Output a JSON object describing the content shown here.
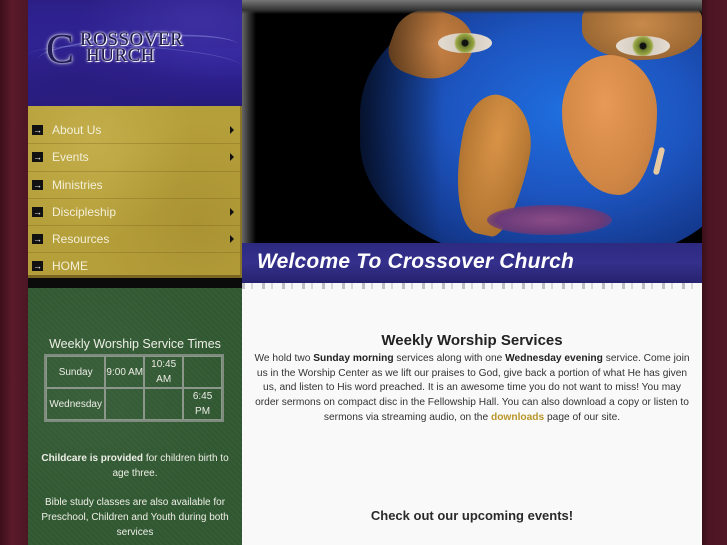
{
  "site": {
    "logo_line1": "ROSSOVER",
    "logo_line2": "HURCH",
    "logo_initial": "C",
    "logo_alt": "Crossover Church"
  },
  "nav": {
    "items": [
      {
        "label": "About Us",
        "has_submenu": true,
        "icon": "arrow-right-icon"
      },
      {
        "label": "Events",
        "has_submenu": true,
        "icon": "arrow-right-icon"
      },
      {
        "label": "Ministries",
        "has_submenu": false,
        "icon": "arrow-right-icon"
      },
      {
        "label": "Discipleship",
        "has_submenu": true,
        "icon": "arrow-right-icon"
      },
      {
        "label": "Resources",
        "has_submenu": true,
        "icon": "arrow-right-icon"
      },
      {
        "label": "HOME",
        "has_submenu": false,
        "icon": "arrow-right-icon"
      }
    ]
  },
  "sidebar": {
    "title": "Weekly Worship Service Times",
    "schedule": [
      {
        "day": "Sunday",
        "times": [
          "9:00 AM",
          "10:45 AM",
          ""
        ]
      },
      {
        "day": "Wednesday",
        "times": [
          "",
          "",
          "6:45 PM"
        ]
      }
    ],
    "childcare_bold": "Childcare is provided",
    "childcare_rest": " for children birth to age three.",
    "bible_study": "Bible study classes are also available for Preschool, Children and Youth during both services"
  },
  "hero": {
    "welcome_title": "Welcome To Crossover Church"
  },
  "content": {
    "heading": "Weekly Worship Services",
    "p_part1": "We hold two ",
    "p_bold1": "Sunday morning",
    "p_part2": " services along with one ",
    "p_bold2": "Wednesday evening",
    "p_part3": " service.  Come join us in the Worship Center as we lift our praises to God, give back a portion of what He has given us, and listen to His word preached. It is an awesome time you do not want to miss!  You may order sermons on compact disc in the Fellowship Hall. You can also download a copy or listen to sermons via streaming audio, on the ",
    "p_link": "downloads",
    "p_part4": " page of our site.",
    "events_text": "Check out our upcoming events!"
  },
  "colors": {
    "nav_gold": "#b59f3a",
    "sidebar_green": "#345c35",
    "banner_blue": "#2d2a80",
    "link_gold": "#b8972a",
    "page_bg": "#4a1422"
  }
}
